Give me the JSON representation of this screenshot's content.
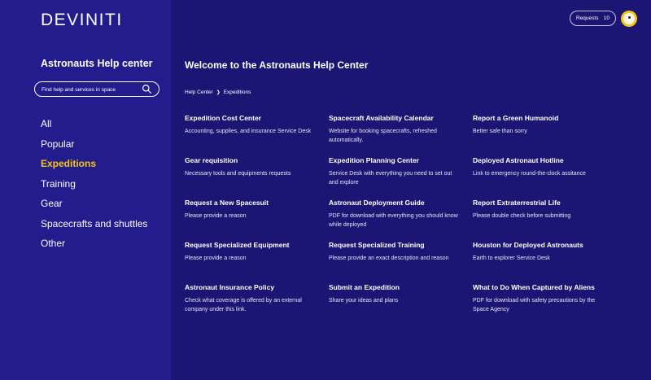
{
  "brand": {
    "logo": "DEVINITI"
  },
  "sidebar": {
    "title": "Astronauts Help center",
    "search_placeholder": "Find help and services in space",
    "nav": [
      {
        "label": "All",
        "active": false
      },
      {
        "label": "Popular",
        "active": false
      },
      {
        "label": "Expeditions",
        "active": true
      },
      {
        "label": "Training",
        "active": false
      },
      {
        "label": "Gear",
        "active": false
      },
      {
        "label": "Spacecrafts and shuttles",
        "active": false
      },
      {
        "label": "Other",
        "active": false
      }
    ]
  },
  "header": {
    "requests_label": "Requests",
    "requests_count": "10"
  },
  "main": {
    "welcome": "Welcome to the Astronauts Help Center",
    "breadcrumb": [
      "Help Center",
      "Expeditions"
    ],
    "cards": [
      {
        "title": "Expedition Cost Center",
        "desc": "Accounting, supplies, and insurance Service Desk"
      },
      {
        "title": "Spacecraft Availability Calendar",
        "desc": "Website for booking spacecrafts, refreshed automatically."
      },
      {
        "title": "Report a Green Humanoid",
        "desc": "Better safe than sorry"
      },
      {
        "title": "Gear requisition",
        "desc": "Necessary tools and equipments requests"
      },
      {
        "title": "Expedition Planning Center",
        "desc": "Service Desk with everything you need to set out and explore"
      },
      {
        "title": "Deployed Astronaut Hotline",
        "desc": "Link to emergency round-the-clock assitance"
      },
      {
        "title": "Request a New Spacesuit",
        "desc": "Please provide a reason"
      },
      {
        "title": "Astronaut Deployment Guide",
        "desc": "PDF for download with everything you should know while deployed"
      },
      {
        "title": "Report Extraterrestrial Life",
        "desc": "Please double check before submitting"
      },
      {
        "title": "Request Specialized Equipment",
        "desc": "Please provide a reason"
      },
      {
        "title": "Request Specialized Training",
        "desc": "Please provide an exact description and reason"
      },
      {
        "title": "Houston for Deployed Astronauts",
        "desc": "Earth to explorer Service Desk"
      },
      {
        "title": "Astronaut Insurance Policy",
        "desc": "Check what coverage is offered by an external company under this link."
      },
      {
        "title": "Submit an Expedition",
        "desc": "Share your ideas and plans"
      },
      {
        "title": "What to Do When Captured by Aliens",
        "desc": "PDF for download with safety precautions by the Space Agency"
      }
    ]
  },
  "colors": {
    "background": "#1b1674",
    "sidebar": "#221c8c",
    "accent": "#f5c518"
  }
}
